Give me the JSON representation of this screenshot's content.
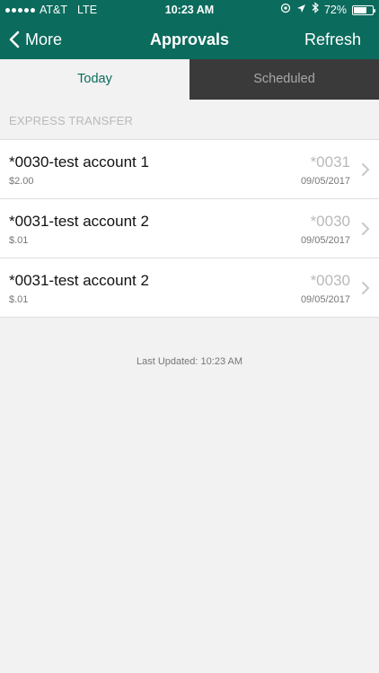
{
  "status_bar": {
    "carrier": "AT&T",
    "network": "LTE",
    "time": "10:23 AM",
    "battery": "72%",
    "battery_level": 0.72,
    "icons": [
      "orientation-lock-icon",
      "location-icon",
      "bluetooth-icon",
      "battery-icon"
    ]
  },
  "nav": {
    "back_label": "More",
    "title": "Approvals",
    "refresh_label": "Refresh"
  },
  "tabs": [
    {
      "label": "Today",
      "selected": true
    },
    {
      "label": "Scheduled",
      "selected": false
    }
  ],
  "section_header": "EXPRESS TRANSFER",
  "items": [
    {
      "title": "*0030-test account 1",
      "amount": "$2.00",
      "account": "*0031",
      "date": "09/05/2017"
    },
    {
      "title": "*0031-test account 2",
      "amount": "$.01",
      "account": "*0030",
      "date": "09/05/2017"
    },
    {
      "title": "*0031-test account 2",
      "amount": "$.01",
      "account": "*0030",
      "date": "09/05/2017"
    }
  ],
  "last_updated": "Last Updated: 10:23 AM",
  "colors": {
    "brand": "#0b6b5d",
    "tab_inactive_bg": "#3a3a3a",
    "background": "#f2f2f2"
  }
}
